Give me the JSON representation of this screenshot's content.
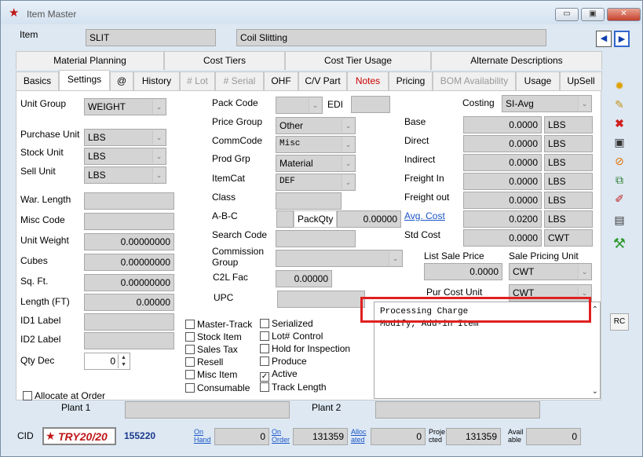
{
  "window": {
    "title": "Item Master",
    "minimize": "▭",
    "maximize": "▣",
    "close": "✕"
  },
  "header": {
    "item_label": "Item",
    "item_code": "SLIT",
    "item_desc": "Coil Slitting",
    "prev": "◀",
    "next": "▶"
  },
  "tabs_top": [
    "Material Planning",
    "Cost Tiers",
    "Cost Tier Usage",
    "Alternate Descriptions"
  ],
  "tabs": [
    "Basics",
    "Settings",
    "@",
    "History",
    "# Lot",
    "# Serial",
    "OHF",
    "C/V Part",
    "Notes",
    "Pricing",
    "BOM Availability",
    "Usage",
    "UpSell"
  ],
  "left": {
    "unit_group_label": "Unit Group",
    "unit_group": "WEIGHT",
    "purchase_unit_label": "Purchase Unit",
    "purchase_unit": "LBS",
    "stock_unit_label": "Stock Unit",
    "stock_unit": "LBS",
    "sell_unit_label": "Sell Unit",
    "sell_unit": "LBS",
    "war_length_label": "War. Length",
    "misc_code_label": "Misc Code",
    "unit_weight_label": "Unit Weight",
    "unit_weight": "0.00000000",
    "cubes_label": "Cubes",
    "cubes": "0.00000000",
    "sqft_label": "Sq. Ft.",
    "sqft": "0.00000000",
    "length_label": "Length (FT)",
    "length": "0.00000",
    "id1_label": "ID1 Label",
    "id2_label": "ID2 Label",
    "qty_dec_label": "Qty Dec",
    "qty_dec": "0",
    "allocate_label": "Allocate at Order"
  },
  "mid": {
    "pack_code_label": "Pack Code",
    "edi_label": "EDI",
    "price_group_label": "Price Group",
    "price_group": "Other",
    "commcode_label": "CommCode",
    "commcode": "Misc",
    "prod_grp_label": "Prod Grp",
    "prod_grp": "Material",
    "itemcat_label": "ItemCat",
    "itemcat": "DEF",
    "class_label": "Class",
    "abc_label": "A-B-C",
    "packqty_label": "PackQty",
    "packqty": "0.00000",
    "search_code_label": "Search Code",
    "commission_label": "Commission Group",
    "c2l_label": "C2L Fac",
    "c2l": "0.00000",
    "upc_label": "UPC"
  },
  "checkboxes_col1": [
    {
      "label": "Master-Track",
      "checked": false
    },
    {
      "label": "Stock Item",
      "checked": false
    },
    {
      "label": "Sales Tax",
      "checked": false
    },
    {
      "label": "Resell",
      "checked": false
    },
    {
      "label": "Misc Item",
      "checked": false
    },
    {
      "label": "Consumable",
      "checked": false
    }
  ],
  "checkboxes_col2": [
    {
      "label": "Serialized",
      "checked": false
    },
    {
      "label": "Lot# Control",
      "checked": false
    },
    {
      "label": "Hold for Inspection",
      "checked": false
    },
    {
      "label": "Produce",
      "checked": false
    },
    {
      "label": "Active",
      "checked": true
    },
    {
      "label": "Track Length",
      "checked": false
    }
  ],
  "costing": {
    "costing_label": "Costing",
    "costing": "SI-Avg",
    "base_label": "Base",
    "base": "0.0000",
    "base_unit": "LBS",
    "direct_label": "Direct",
    "direct": "0.0000",
    "direct_unit": "LBS",
    "indirect_label": "Indirect",
    "indirect": "0.0000",
    "indirect_unit": "LBS",
    "freight_in_label": "Freight In",
    "freight_in": "0.0000",
    "freight_in_unit": "LBS",
    "freight_out_label": "Freight out",
    "freight_out": "0.0000",
    "freight_out_unit": "LBS",
    "avg_cost_label": "Avg. Cost",
    "avg_cost": "0.0200",
    "avg_cost_unit": "LBS",
    "std_cost_label": "Std Cost",
    "std_cost": "0.0000",
    "std_cost_unit": "CWT",
    "list_sale_price_label": "List Sale Price",
    "list_sale_price": "0.0000",
    "sale_pricing_unit_label": "Sale Pricing Unit",
    "sale_pricing_unit": "CWT",
    "pur_cost_unit_label": "Pur Cost Unit",
    "pur_cost_unit": "CWT"
  },
  "notes": {
    "line1": "Processing Charge",
    "line2": "Modify, Add-in Item"
  },
  "rc_button": "RC",
  "plants": {
    "plant1_label": "Plant 1",
    "plant2_label": "Plant 2"
  },
  "footer": {
    "cid_label": "CID",
    "logo_text": "TRY20/20",
    "cid": "155220",
    "on_hand_label": "On Hand",
    "on_hand": "0",
    "on_order_label": "On Order",
    "on_order": "131359",
    "allocated_label": "Alloc ated",
    "allocated": "0",
    "projected_label": "Proje cted",
    "projected": "131359",
    "available_label": "Avail able",
    "available": "0"
  },
  "highlight_color": "#e02020"
}
